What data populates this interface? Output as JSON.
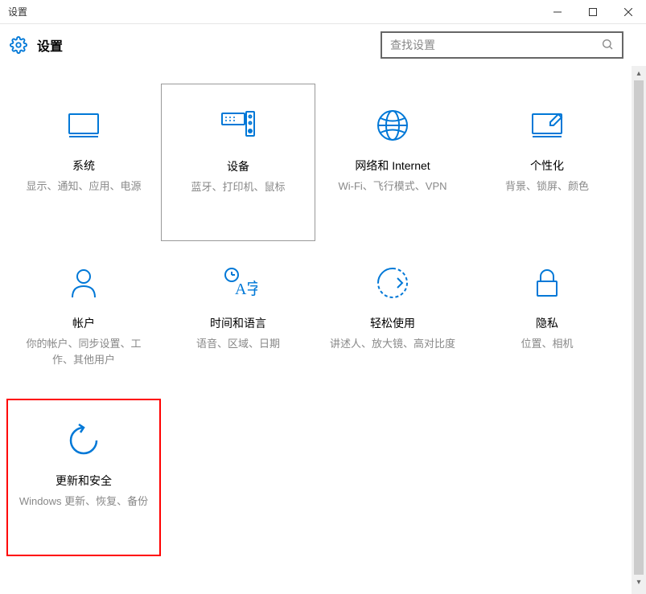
{
  "window": {
    "title": "设置"
  },
  "header": {
    "title": "设置",
    "search_placeholder": "查找设置"
  },
  "tiles": [
    {
      "title": "系统",
      "desc": "显示、通知、应用、电源"
    },
    {
      "title": "设备",
      "desc": "蓝牙、打印机、鼠标"
    },
    {
      "title": "网络和 Internet",
      "desc": "Wi-Fi、飞行模式、VPN"
    },
    {
      "title": "个性化",
      "desc": "背景、锁屏、颜色"
    },
    {
      "title": "帐户",
      "desc": "你的帐户、同步设置、工作、其他用户"
    },
    {
      "title": "时间和语言",
      "desc": "语音、区域、日期"
    },
    {
      "title": "轻松使用",
      "desc": "讲述人、放大镜、高对比度"
    },
    {
      "title": "隐私",
      "desc": "位置、相机"
    },
    {
      "title": "更新和安全",
      "desc": "Windows 更新、恢复、备份"
    }
  ]
}
